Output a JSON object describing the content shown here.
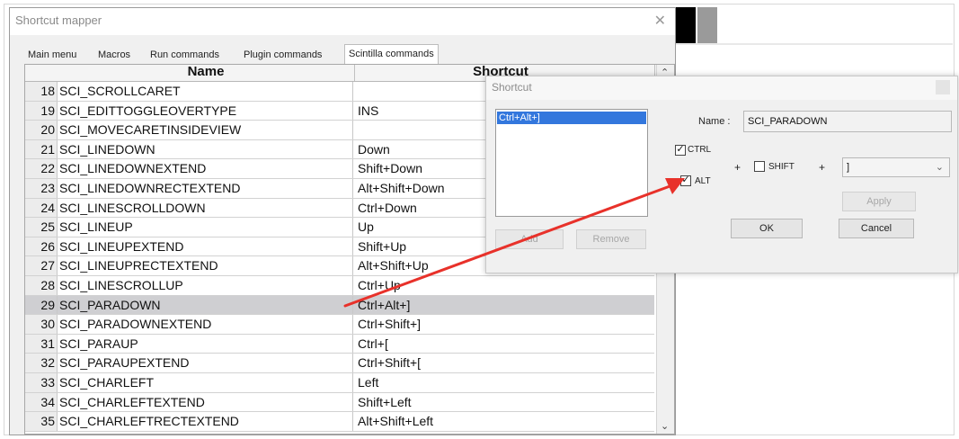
{
  "main_window": {
    "title": "Shortcut mapper",
    "close_glyph": "✕",
    "tabs": [
      "Main menu",
      "Macros",
      "Run commands",
      "Plugin commands",
      "Scintilla commands"
    ],
    "active_tab_index": 4
  },
  "grid": {
    "columns": {
      "name": "Name",
      "shortcut": "Shortcut"
    },
    "rows": [
      {
        "num": "18",
        "name": "SCI_SCROLLCARET",
        "shortcut": ""
      },
      {
        "num": "19",
        "name": "SCI_EDITTOGGLEOVERTYPE",
        "shortcut": "INS"
      },
      {
        "num": "20",
        "name": "SCI_MOVECARETINSIDEVIEW",
        "shortcut": ""
      },
      {
        "num": "21",
        "name": "SCI_LINEDOWN",
        "shortcut": "Down"
      },
      {
        "num": "22",
        "name": "SCI_LINEDOWNEXTEND",
        "shortcut": "Shift+Down"
      },
      {
        "num": "23",
        "name": "SCI_LINEDOWNRECTEXTEND",
        "shortcut": "Alt+Shift+Down"
      },
      {
        "num": "24",
        "name": "SCI_LINESCROLLDOWN",
        "shortcut": "Ctrl+Down"
      },
      {
        "num": "25",
        "name": "SCI_LINEUP",
        "shortcut": "Up"
      },
      {
        "num": "26",
        "name": "SCI_LINEUPEXTEND",
        "shortcut": "Shift+Up"
      },
      {
        "num": "27",
        "name": "SCI_LINEUPRECTEXTEND",
        "shortcut": "Alt+Shift+Up"
      },
      {
        "num": "28",
        "name": "SCI_LINESCROLLUP",
        "shortcut": "Ctrl+Up"
      },
      {
        "num": "29",
        "name": "SCI_PARADOWN",
        "shortcut": "Ctrl+Alt+]",
        "selected": true
      },
      {
        "num": "30",
        "name": "SCI_PARADOWNEXTEND",
        "shortcut": "Ctrl+Shift+]"
      },
      {
        "num": "31",
        "name": "SCI_PARAUP",
        "shortcut": "Ctrl+["
      },
      {
        "num": "32",
        "name": "SCI_PARAUPEXTEND",
        "shortcut": "Ctrl+Shift+["
      },
      {
        "num": "33",
        "name": "SCI_CHARLEFT",
        "shortcut": "Left"
      },
      {
        "num": "34",
        "name": "SCI_CHARLEFTEXTEND",
        "shortcut": "Shift+Left"
      },
      {
        "num": "35",
        "name": "SCI_CHARLEFTRECTEXTEND",
        "shortcut": "Alt+Shift+Left"
      }
    ],
    "scroll_up_glyph": "⌃",
    "scroll_down_glyph": "⌄"
  },
  "dialog": {
    "title": "Shortcut",
    "list_items": [
      "Ctrl+Alt+]"
    ],
    "add_label": "Add",
    "remove_label": "Remove",
    "name_label": "Name :",
    "name_value": "SCI_PARADOWN",
    "ctrl_label": "CTRL",
    "ctrl_checked": true,
    "alt_label": "ALT",
    "alt_checked": true,
    "shift_label": "SHIFT",
    "shift_checked": false,
    "plus_glyph": "+",
    "key_value": "]",
    "key_arrow_glyph": "⌄",
    "apply_label": "Apply",
    "ok_label": "OK",
    "cancel_label": "Cancel",
    "check_glyph": "✓"
  },
  "colors": {
    "arrow": "#e8312a",
    "selection": "#3377dd",
    "selected_row": "#cfcfd2"
  }
}
